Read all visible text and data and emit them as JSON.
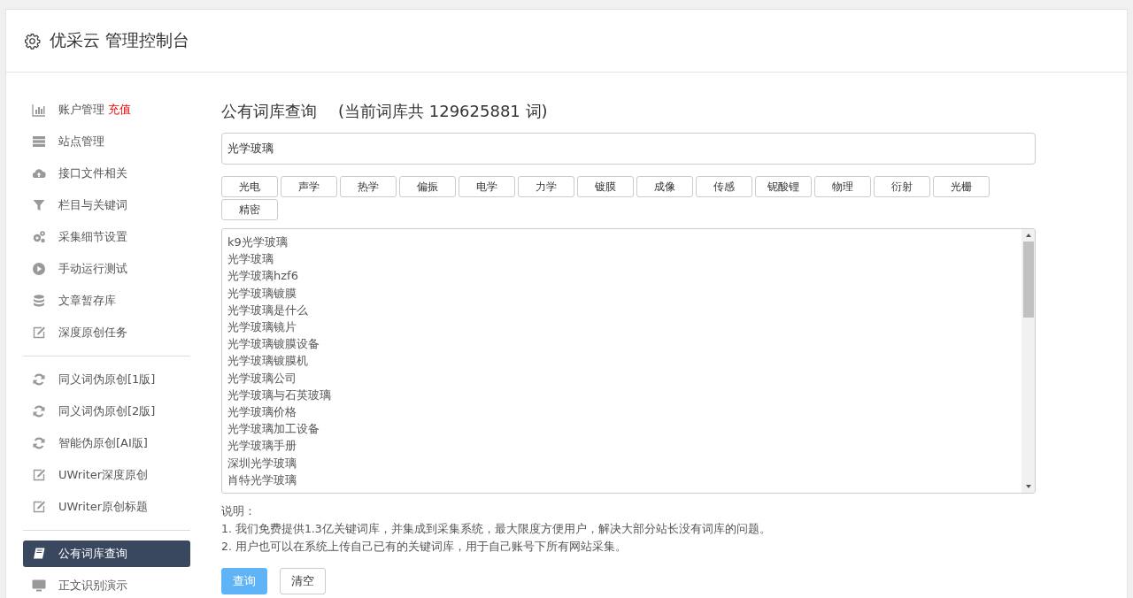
{
  "header": {
    "title": "优采云 管理控制台"
  },
  "sidebar": {
    "groups": [
      {
        "items": [
          {
            "label": "账户管理",
            "badge": "充值",
            "selected": false
          },
          {
            "label": "站点管理",
            "selected": false
          },
          {
            "label": "接口文件相关",
            "selected": false
          },
          {
            "label": "栏目与关键词",
            "selected": false
          },
          {
            "label": "采集细节设置",
            "selected": false
          },
          {
            "label": "手动运行测试",
            "selected": false
          },
          {
            "label": "文章暂存库",
            "selected": false
          },
          {
            "label": "深度原创任务",
            "selected": false
          }
        ]
      },
      {
        "items": [
          {
            "label": "同义词伪原创[1版]",
            "selected": false
          },
          {
            "label": "同义词伪原创[2版]",
            "selected": false
          },
          {
            "label": "智能伪原创[AI版]",
            "selected": false
          },
          {
            "label": "UWriter深度原创",
            "selected": false
          },
          {
            "label": "UWriter原创标题",
            "selected": false
          }
        ]
      },
      {
        "items": [
          {
            "label": "公有词库查询",
            "selected": true
          },
          {
            "label": "正文识别演示",
            "selected": false
          }
        ]
      }
    ]
  },
  "main": {
    "title": "公有词库查询",
    "count_note": "(当前词库共 129625881 词)",
    "search": {
      "value": "光学玻璃"
    },
    "tags": [
      "光电",
      "声学",
      "热学",
      "偏振",
      "电学",
      "力学",
      "镀膜",
      "成像",
      "传感",
      "铌酸锂",
      "物理",
      "衍射",
      "光栅",
      "精密"
    ],
    "results": [
      "k9光学玻璃",
      "光学玻璃",
      "光学玻璃hzf6",
      "光学玻璃镀膜",
      "光学玻璃是什么",
      "光学玻璃镜片",
      "光学玻璃镀膜设备",
      "光学玻璃镀膜机",
      "光学玻璃公司",
      "光学玻璃与石英玻璃",
      "光学玻璃价格",
      "光学玻璃加工设备",
      "光学玻璃手册",
      "深圳光学玻璃",
      "肖特光学玻璃"
    ],
    "notes_title": "说明：",
    "notes": [
      "1. 我们免费提供1.3亿关键词库，并集成到采集系统，最大限度方便用户，解决大部分站长没有词库的问题。",
      "2. 用户也可以在系统上传自己已有的关键词库，用于自己账号下所有网站采集。"
    ],
    "buttons": [
      {
        "label": "查询",
        "kind": "primary"
      },
      {
        "label": "清空",
        "kind": "default"
      }
    ]
  }
}
